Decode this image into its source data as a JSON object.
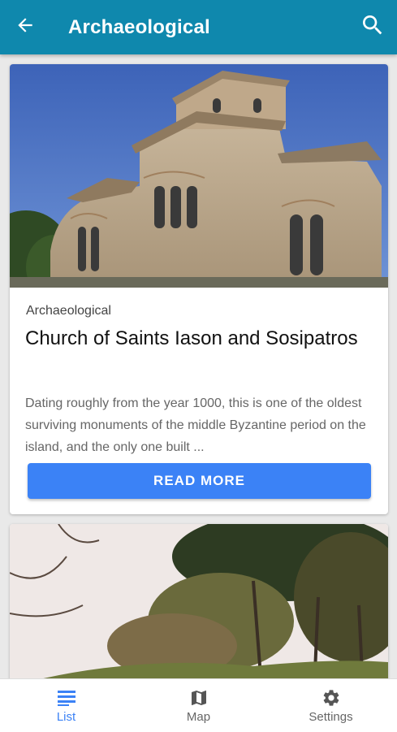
{
  "header": {
    "title": "Archaeological",
    "back_icon": "arrow-left-icon",
    "search_icon": "search-icon",
    "background": "#0f88ad"
  },
  "cards": [
    {
      "category": "Archaeological",
      "title": "Church of Saints Iason and Sosipatros",
      "description": "Dating roughly from the year 1000, this is one of the oldest surviving monuments of the middle Byzantine period on the island, and the only one built ...",
      "button_label": "READ MORE",
      "image": "church-photo"
    },
    {
      "image": "archaeological-site-trees-photo"
    }
  ],
  "bottom_nav": {
    "items": [
      {
        "label": "List",
        "icon": "list-icon",
        "active": true
      },
      {
        "label": "Map",
        "icon": "map-icon",
        "active": false
      },
      {
        "label": "Settings",
        "icon": "gear-icon",
        "active": false
      }
    ]
  },
  "colors": {
    "accent": "#3b82f6",
    "appbar": "#0f88ad"
  }
}
